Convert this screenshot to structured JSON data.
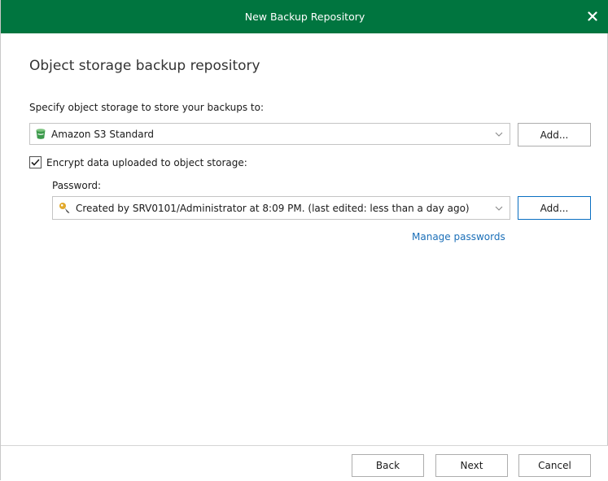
{
  "window": {
    "title": "New Backup Repository"
  },
  "main": {
    "section_title": "Object storage backup repository",
    "storage_label": "Specify object storage to store your backups to:",
    "storage_value": "Amazon S3 Standard",
    "storage_add_label": "Add...",
    "encrypt_label": "Encrypt data uploaded to object storage:",
    "encrypt_checked": true,
    "password_label": "Password:",
    "password_value": "Created by SRV0101/Administrator at 8:09 PM. (last edited: less than a day ago)",
    "password_add_label": "Add...",
    "manage_passwords_link": "Manage passwords"
  },
  "footer": {
    "back_label": "Back",
    "next_label": "Next",
    "cancel_label": "Cancel"
  },
  "icons": {
    "close": "close-icon",
    "storage": "bucket-icon",
    "password": "key-icon",
    "dropdown": "chevron-down-icon",
    "check": "checkmark-icon"
  },
  "colors": {
    "titlebar": "#00753f",
    "link": "#1b6fb8",
    "focus_border": "#0a6fc2"
  }
}
